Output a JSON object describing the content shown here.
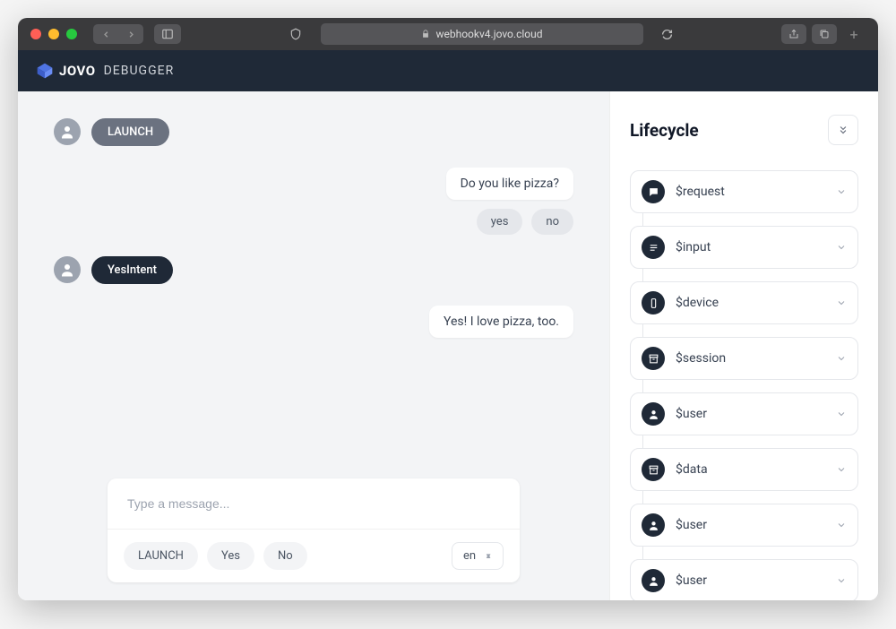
{
  "browser": {
    "url": "webhookv4.jovo.cloud"
  },
  "header": {
    "brand": "JOVO",
    "product": "DEBUGGER"
  },
  "chat": {
    "messages": [
      {
        "from": "user",
        "style": "light",
        "text": "LAUNCH"
      },
      {
        "from": "bot",
        "text": "Do you like pizza?",
        "quick": [
          "yes",
          "no"
        ]
      },
      {
        "from": "user",
        "style": "dark",
        "text": "YesIntent"
      },
      {
        "from": "bot",
        "text": "Yes! I love pizza, too."
      }
    ],
    "composer": {
      "placeholder": "Type a message...",
      "suggestions": [
        "LAUNCH",
        "Yes",
        "No"
      ],
      "lang": "en"
    }
  },
  "lifecycle": {
    "title": "Lifecycle",
    "items": [
      {
        "icon": "chat",
        "label": "$request"
      },
      {
        "icon": "lines",
        "label": "$input"
      },
      {
        "icon": "device",
        "label": "$device"
      },
      {
        "icon": "archive",
        "label": "$session"
      },
      {
        "icon": "user",
        "label": "$user"
      },
      {
        "icon": "archive",
        "label": "$data"
      },
      {
        "icon": "user",
        "label": "$user"
      },
      {
        "icon": "user",
        "label": "$user"
      }
    ]
  }
}
